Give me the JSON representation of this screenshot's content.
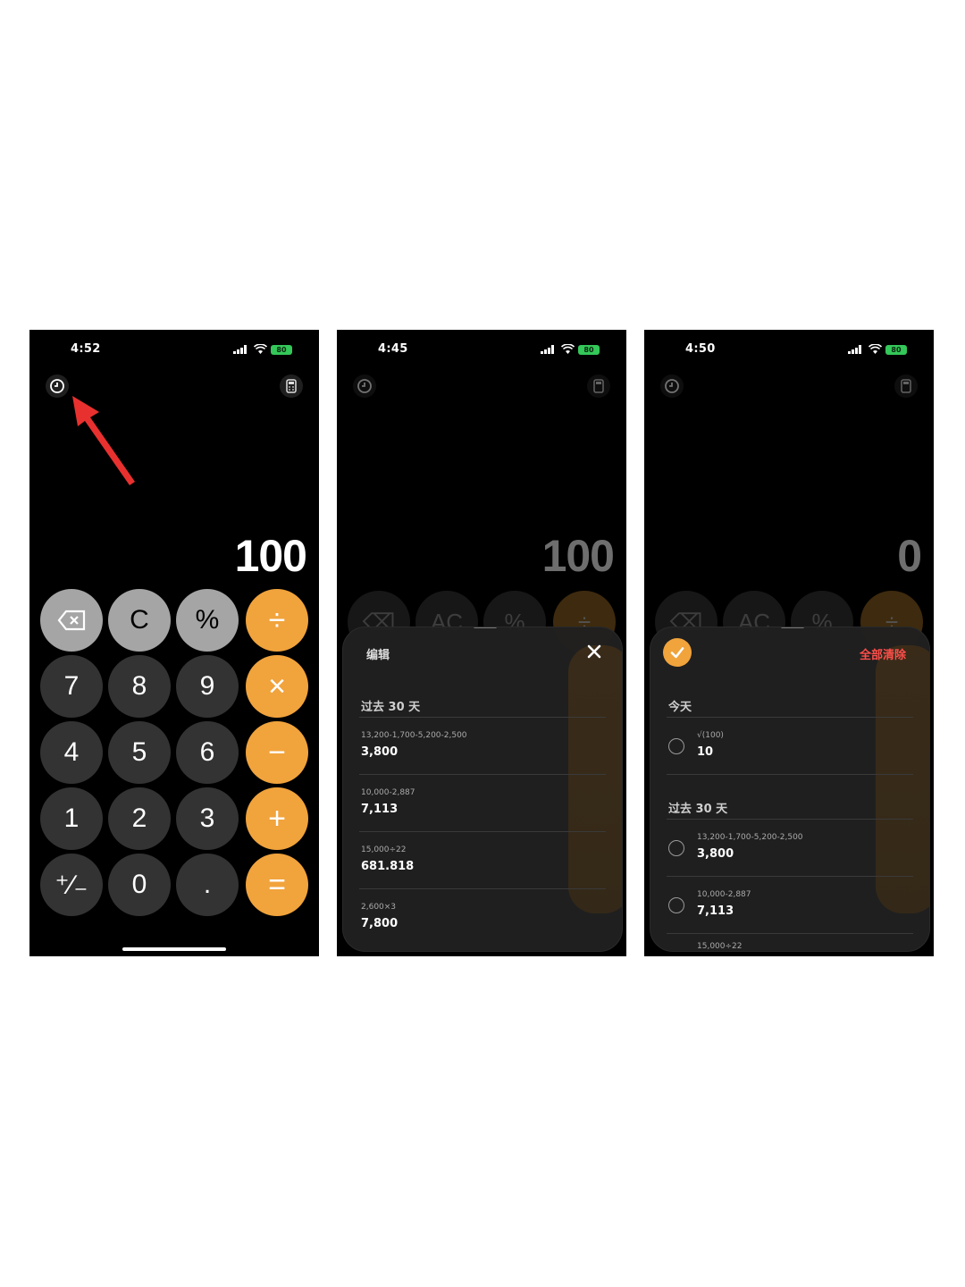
{
  "phones": [
    {
      "time": "4:52",
      "battery": "80",
      "display": "100",
      "keys": [
        "⌫",
        "C",
        "%",
        "÷",
        "7",
        "8",
        "9",
        "×",
        "4",
        "5",
        "6",
        "−",
        "1",
        "2",
        "3",
        "+",
        "⁺∕₋",
        "0",
        ".",
        "="
      ]
    },
    {
      "time": "4:45",
      "battery": "80",
      "display": "100",
      "ghost_keys": [
        "⌫",
        "AC",
        "%",
        "÷"
      ],
      "sheet": {
        "edit_label": "编辑",
        "sections": [
          {
            "title": "过去 30 天",
            "items": [
              {
                "expr": "13,200-1,700-5,200-2,500",
                "result": "3,800"
              },
              {
                "expr": "10,000-2,887",
                "result": "7,113"
              },
              {
                "expr": "15,000÷22",
                "result": "681.818"
              },
              {
                "expr": "2,600×3",
                "result": "7,800"
              }
            ]
          }
        ]
      }
    },
    {
      "time": "4:50",
      "battery": "80",
      "display": "0",
      "ghost_keys": [
        "⌫",
        "AC",
        "%",
        "÷"
      ],
      "sheet": {
        "clear_all_label": "全部清除",
        "sections": [
          {
            "title": "今天",
            "items": [
              {
                "expr": "√(100)",
                "result": "10"
              }
            ]
          },
          {
            "title": "过去 30 天",
            "items": [
              {
                "expr": "13,200-1,700-5,200-2,500",
                "result": "3,800"
              },
              {
                "expr": "10,000-2,887",
                "result": "7,113"
              },
              {
                "expr": "15,000÷22",
                "result": ""
              }
            ]
          }
        ]
      }
    }
  ],
  "colors": {
    "operator": "#f1a33c",
    "function": "#a5a5a5",
    "number": "#333333",
    "clear_all": "#ff4f4a",
    "arrow": "#e8312f"
  }
}
